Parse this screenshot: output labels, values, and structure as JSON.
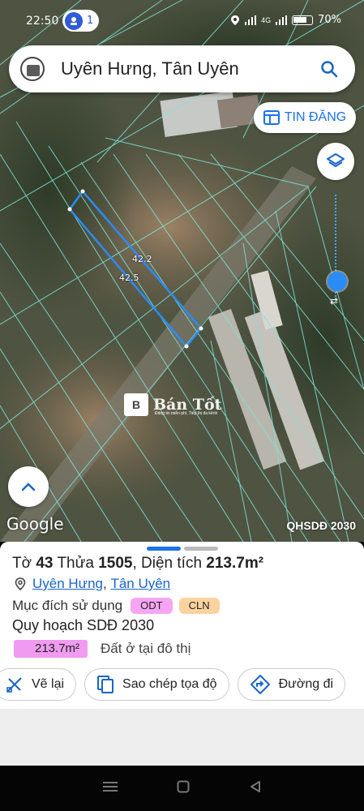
{
  "status_bar": {
    "time": "22:50",
    "notification_count": "1",
    "network": "4G",
    "battery": "70%"
  },
  "search": {
    "query": "Uyên Hưng, Tân Uyên"
  },
  "map": {
    "tin_dang_label": "TIN ĐĂNG",
    "dimension_top": "42.2",
    "dimension_bottom": "42.5",
    "google_label": "Google",
    "overlay_label": "QHSDĐ 2030",
    "watermark": "Bán Tốt",
    "watermark_sub": "Đăng tin miễn phí, Tiếp thị đa kênh",
    "parcel_outline_color": "#2b8cf7",
    "parcel_line_color": "#7fe3d6"
  },
  "parcel": {
    "to_label": "Tờ",
    "to_value": "43",
    "thua_label": "Thửa",
    "thua_value": "1505",
    "area_label": "Diện tích",
    "area_value": "213.7m²",
    "ward": "Uyên Hưng",
    "district": "Tân Uyên",
    "purpose_label": "Mục đích sử dụng",
    "purpose_tags": [
      {
        "code": "ODT",
        "color": "#f5a6f2"
      },
      {
        "code": "CLN",
        "color": "#fbd3a0"
      }
    ],
    "plan_label": "Quy hoạch SDĐ 2030",
    "plan_area": "213.7m²",
    "plan_desc": "Đất ở tại đô thị"
  },
  "actions": {
    "draw_label": "Vẽ lại",
    "copy_label": "Sao chép tọa độ",
    "route_label": "Đường đi"
  },
  "nav": {
    "menu_icon": "menu-icon",
    "home_icon": "home-icon",
    "back_icon": "back-icon"
  }
}
